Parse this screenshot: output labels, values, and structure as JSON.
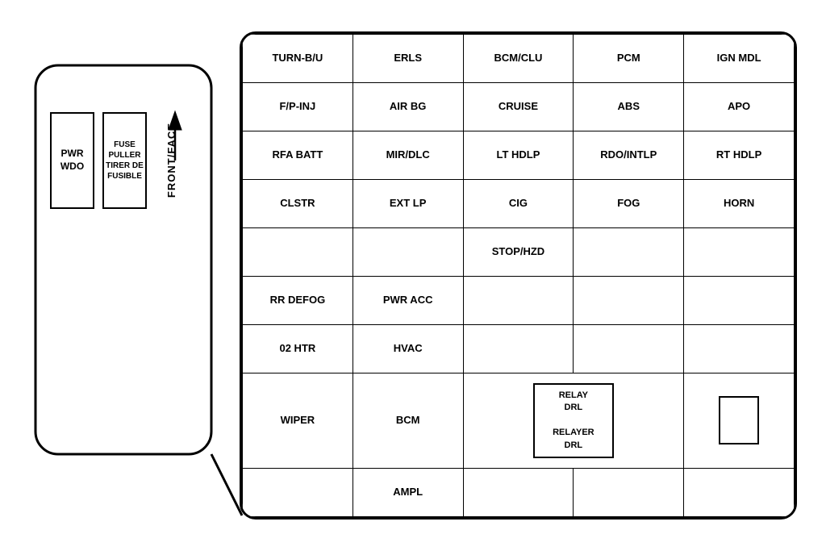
{
  "diagram": {
    "left": {
      "pwr_wdo": "PWR WDO",
      "fuse_puller": "FUSE PULLER TIRER DE FUSIBLE",
      "front_face": "FRONT/FACE"
    },
    "table": {
      "rows": [
        [
          "TURN-B/U",
          "ERLS",
          "BCM/CLU",
          "PCM",
          "IGN MDL"
        ],
        [
          "F/P-INJ",
          "AIR BG",
          "CRUISE",
          "ABS",
          "APO"
        ],
        [
          "RFA BATT",
          "MIR/DLC",
          "LT HDLP",
          "RDO/INTLP",
          "RT HDLP"
        ],
        [
          "CLSTR",
          "EXT LP",
          "CIG",
          "FOG",
          "HORN"
        ],
        [
          "",
          "",
          "STOP/HZD",
          "",
          ""
        ],
        [
          "RR DEFOG",
          "PWR ACC",
          "",
          "",
          ""
        ],
        [
          "02 HTR",
          "HVAC",
          "",
          "",
          ""
        ],
        [
          "WIPER",
          "BCM",
          "relay",
          "",
          ""
        ],
        [
          "",
          "AMPL",
          "",
          "",
          ""
        ]
      ]
    }
  }
}
